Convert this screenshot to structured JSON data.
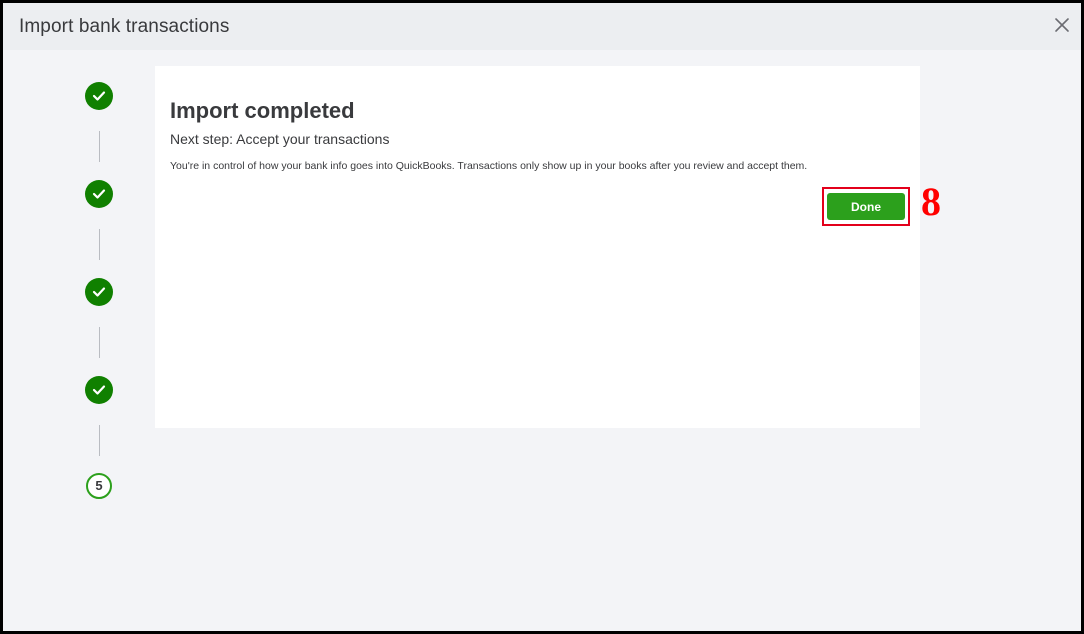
{
  "window": {
    "title": "Import bank transactions",
    "close_icon": "close-icon"
  },
  "stepper": {
    "steps": [
      {
        "state": "complete",
        "icon": "checkmark-icon"
      },
      {
        "state": "complete",
        "icon": "checkmark-icon"
      },
      {
        "state": "complete",
        "icon": "checkmark-icon"
      },
      {
        "state": "complete",
        "icon": "checkmark-icon"
      },
      {
        "state": "current",
        "label": "5"
      }
    ]
  },
  "content": {
    "heading": "Import completed",
    "subheading": "Next step: Accept your transactions",
    "description": "You're in control of how your bank info goes into QuickBooks. Transactions only show up in your books after you review and accept them.",
    "done_label": "Done"
  },
  "annotation": {
    "number": "8"
  },
  "colors": {
    "accent_green": "#2ca01c",
    "check_green": "#108000",
    "annotation_red": "#ff0000"
  }
}
